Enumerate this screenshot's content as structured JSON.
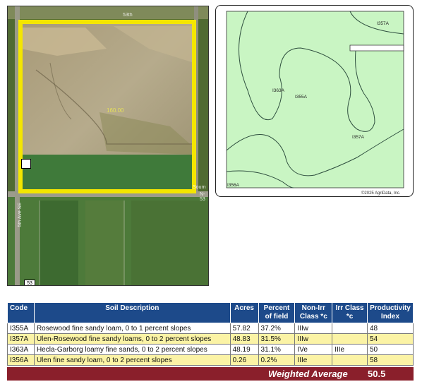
{
  "aerial": {
    "acres_label": "160.00",
    "road_badge": "53",
    "road_top": "53th",
    "road_side": "5th Ave SE",
    "road_right": "N-53",
    "road_mid": "Sourn"
  },
  "soil_map": {
    "labels": [
      "I357A",
      "I363A",
      "I355A",
      "I357A",
      "I356A"
    ],
    "copyright": "©2025 AgriData, Inc."
  },
  "table": {
    "headers": {
      "code": "Code",
      "description": "Soil Description",
      "acres": "Acres",
      "percent_l1": "Percent",
      "percent_l2": "of field",
      "nonirr_l1": "Non-Irr",
      "nonirr_l2": "Class *c",
      "irr_l1": "Irr Class",
      "irr_l2": "*c",
      "prod_l1": "Productivity",
      "prod_l2": "Index"
    },
    "rows": [
      {
        "code": "I355A",
        "description": "Rosewood fine sandy loam, 0 to 1 percent slopes",
        "acres": "57.82",
        "percent": "37.2%",
        "nonirr": "IIIw",
        "irr": "",
        "pi": "48"
      },
      {
        "code": "I357A",
        "description": "Ulen-Rosewood fine sandy loams, 0 to 2 percent slopes",
        "acres": "48.83",
        "percent": "31.5%",
        "nonirr": "IIIw",
        "irr": "",
        "pi": "54"
      },
      {
        "code": "I363A",
        "description": "Hecla-Garborg loamy fine sands, 0 to 2 percent slopes",
        "acres": "48.19",
        "percent": "31.1%",
        "nonirr": "IVe",
        "irr": "IIIe",
        "pi": "50"
      },
      {
        "code": "I356A",
        "description": "Ulen fine sandy loam, 0 to 2 percent slopes",
        "acres": "0.26",
        "percent": "0.2%",
        "nonirr": "IIIe",
        "irr": "",
        "pi": "58"
      }
    ],
    "weighted_average_label": "Weighted Average",
    "weighted_average_value": "50.5"
  },
  "colors": {
    "header_blue": "#1d4a8a",
    "row_yellow": "#fbf3a5",
    "footer_red": "#8a1f2b",
    "soil_green": "#c9f5c3",
    "boundary_yellow": "#f4e600"
  }
}
